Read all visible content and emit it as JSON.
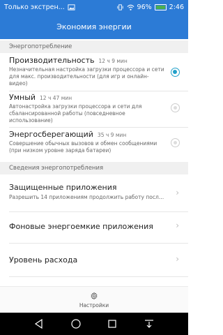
{
  "status_bar": {
    "carrier_text": "Только экстрен...",
    "battery_percent": "96%",
    "time": "2:46",
    "icons": [
      "signal-icon",
      "image-icon",
      "vibrate-icon",
      "wifi-icon",
      "battery-icon"
    ]
  },
  "header": {
    "title": "Экономия энергии"
  },
  "section_power": {
    "label": "Энергопотребление"
  },
  "options": [
    {
      "title": "Производительность",
      "time": "12 ч 9 мин",
      "desc": "Незначительная настройка загрузки процессора и сети для макс. производительности (для игр и онлайн-видео)",
      "selected": true
    },
    {
      "title": "Умный",
      "time": "12 ч 47 мин",
      "desc": "Автонастройка загрузки процессора и сети для сбалансированной работы (повседневное использование)",
      "selected": false
    },
    {
      "title": "Энергосберегающий",
      "time": "35 ч 9 мин",
      "desc": "Совершение обычных вызовов и обмен сообщениями (при низком уровне заряда батареи)",
      "selected": false
    }
  ],
  "section_info": {
    "label": "Сведения энергопотребления"
  },
  "rows": [
    {
      "title": "Защищенные приложения",
      "subtitle": "Разрешить 14 приложениям продолжить работу после..."
    },
    {
      "title": "Фоновые энергоемкие приложения",
      "subtitle": ""
    },
    {
      "title": "Уровень расхода",
      "subtitle": ""
    }
  ],
  "bottom_tab": {
    "label": "Настройки",
    "icon": "gear-icon"
  },
  "colors": {
    "accent": "#2c7bd6",
    "radio_selected": "#21a0c9",
    "battery_fill": "#4caf50"
  }
}
